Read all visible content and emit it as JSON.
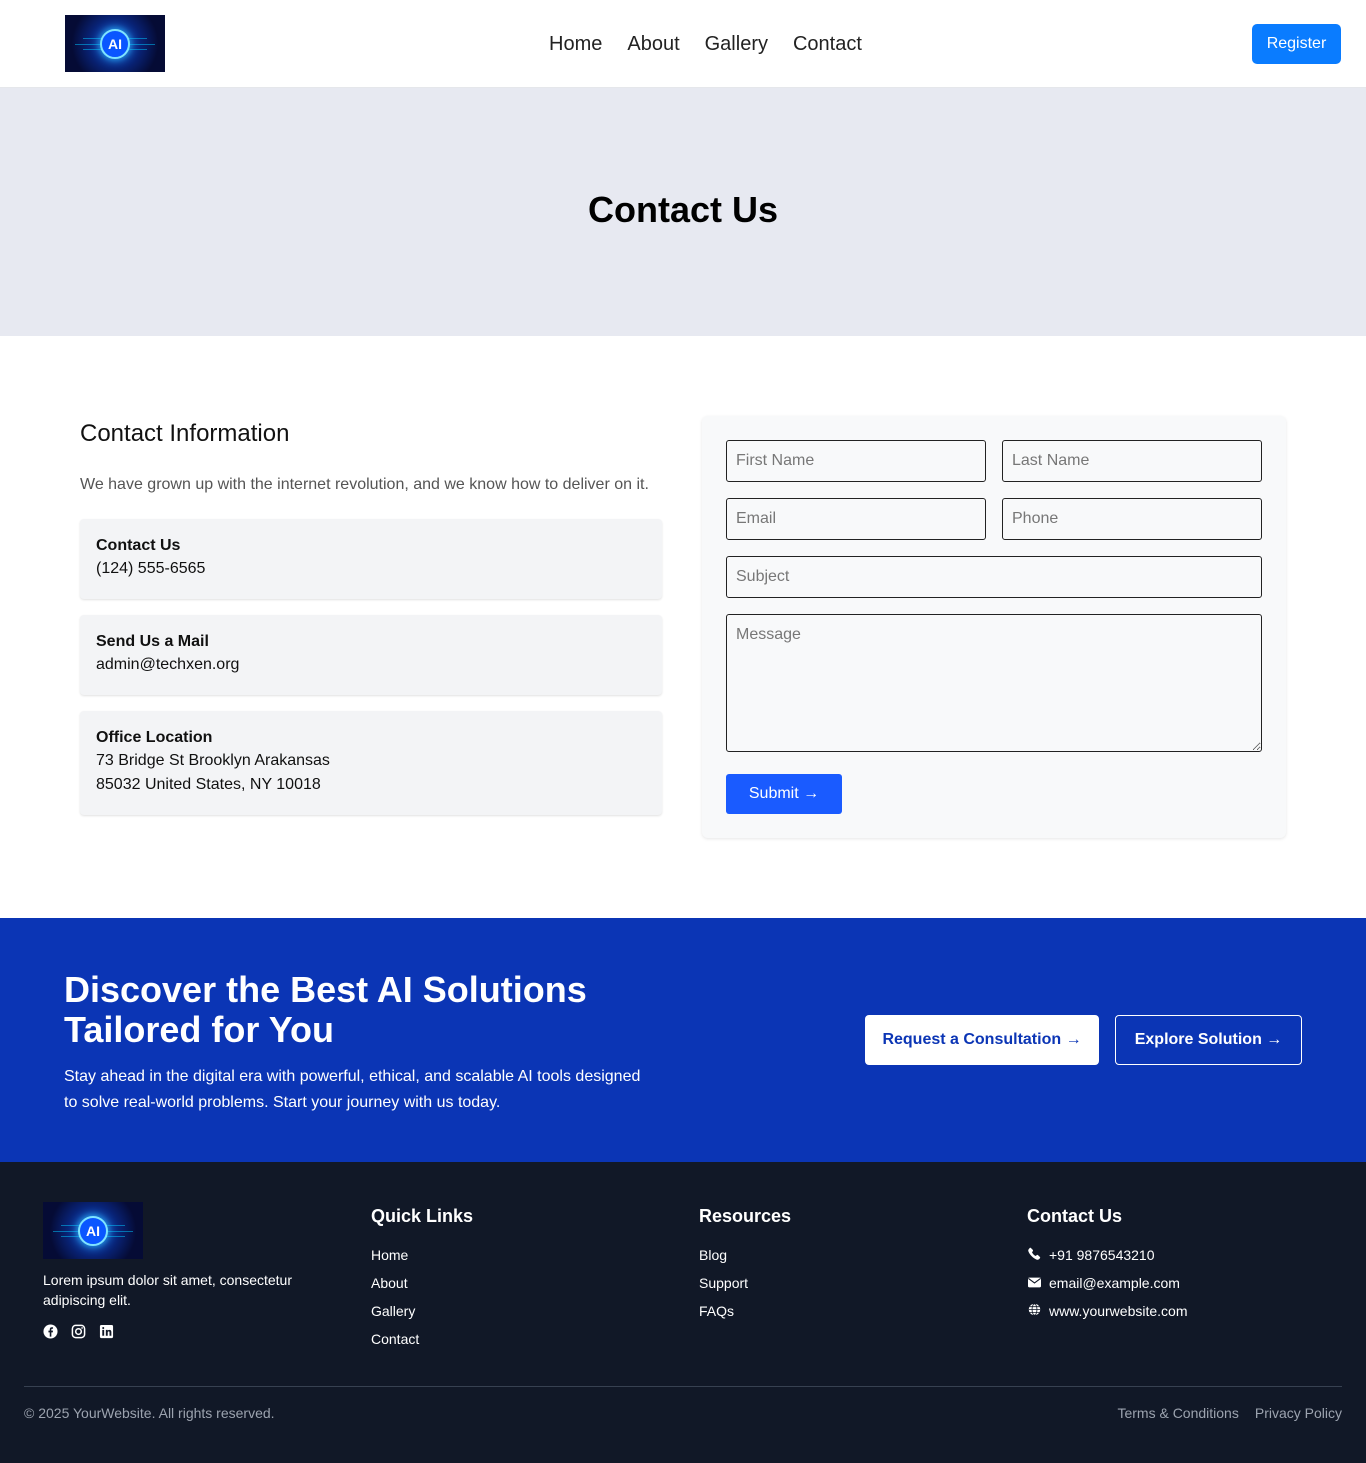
{
  "nav": {
    "logo_text": "AI",
    "links": [
      "Home",
      "About",
      "Gallery",
      "Contact"
    ],
    "register_label": "Register"
  },
  "hero": {
    "title": "Contact Us"
  },
  "contact_info": {
    "heading": "Contact Information",
    "lead": "We have grown up with the internet revolution, and we know how to deliver on it.",
    "cards": [
      {
        "title": "Contact Us",
        "lines": [
          "(124) 555-6565"
        ]
      },
      {
        "title": "Send Us a Mail",
        "lines": [
          "admin@techxen.org"
        ]
      },
      {
        "title": "Office Location",
        "lines": [
          "73 Bridge St Brooklyn Arakansas",
          "85032 United States, NY 10018"
        ]
      }
    ]
  },
  "form": {
    "first_name_placeholder": "First Name",
    "last_name_placeholder": "Last Name",
    "email_placeholder": "Email",
    "phone_placeholder": "Phone",
    "subject_placeholder": "Subject",
    "message_placeholder": "Message",
    "submit_label": "Submit →"
  },
  "cta": {
    "title": "Discover the Best AI Solutions Tailored for You",
    "body": "Stay ahead in the digital era with powerful, ethical, and scalable AI tools designed to solve real-world problems. Start your journey with us today.",
    "consult_label": "Request a Consultation →",
    "explore_label": "Explore Solution →",
    "bg_color": "#0b35b5"
  },
  "footer": {
    "logo_text": "AI",
    "about": "Lorem ipsum dolor sit amet, consectetur adipiscing elit.",
    "socials": [
      "facebook-icon",
      "instagram-icon",
      "linkedin-icon"
    ],
    "quick_links": {
      "heading": "Quick Links",
      "items": [
        "Home",
        "About",
        "Gallery",
        "Contact"
      ]
    },
    "resources": {
      "heading": "Resources",
      "items": [
        "Blog",
        "Support",
        "FAQs"
      ]
    },
    "contact": {
      "heading": "Contact Us",
      "phone": "+91 9876543210",
      "email": "email@example.com",
      "website": "www.yourwebsite.com"
    },
    "copyright": "© 2025 YourWebsite. All rights reserved.",
    "terms": "Terms & Conditions",
    "privacy": "Privacy Policy"
  }
}
